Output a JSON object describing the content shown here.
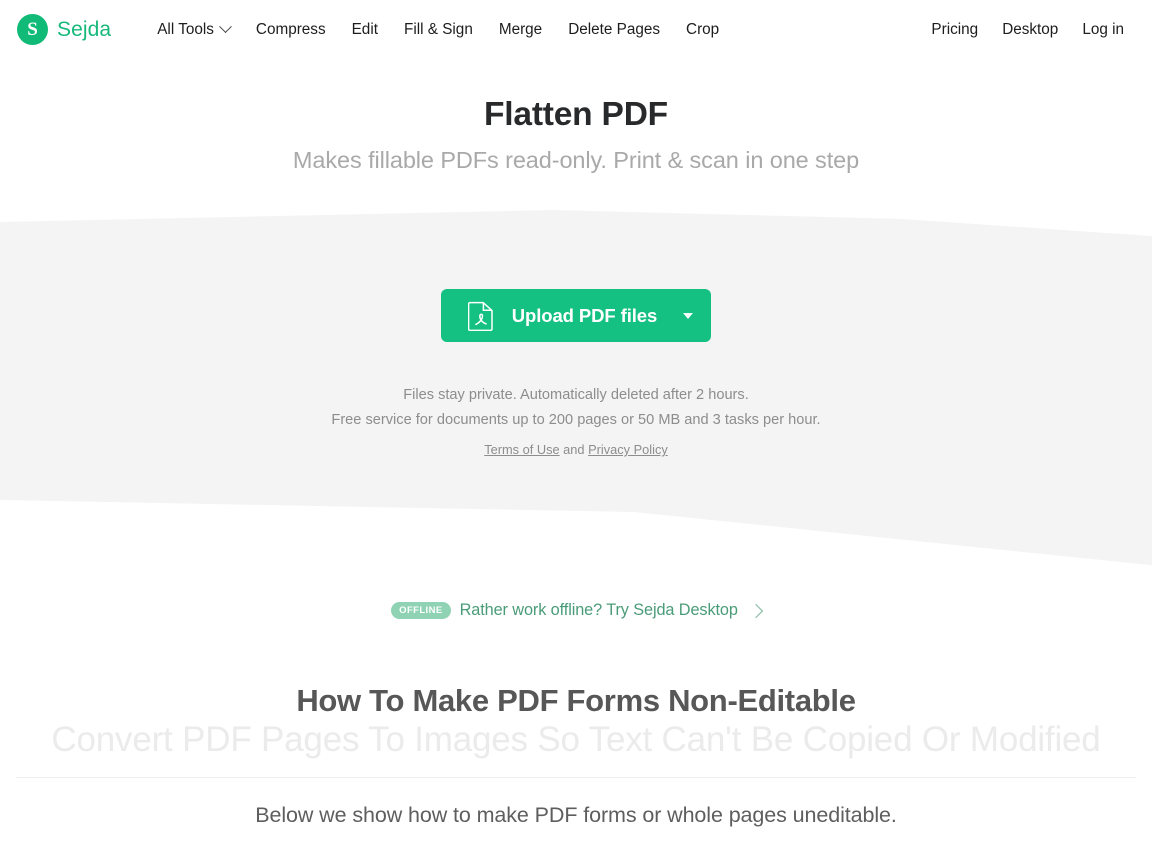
{
  "brand": {
    "mark_letter": "S",
    "name": "Sejda"
  },
  "nav": {
    "main": [
      {
        "label": "All Tools",
        "has_caret": true
      },
      {
        "label": "Compress",
        "has_caret": false
      },
      {
        "label": "Edit",
        "has_caret": false
      },
      {
        "label": "Fill & Sign",
        "has_caret": false
      },
      {
        "label": "Merge",
        "has_caret": false
      },
      {
        "label": "Delete Pages",
        "has_caret": false
      },
      {
        "label": "Crop",
        "has_caret": false
      }
    ],
    "right": [
      {
        "label": "Pricing"
      },
      {
        "label": "Desktop"
      },
      {
        "label": "Log in"
      }
    ]
  },
  "hero": {
    "title": "Flatten PDF",
    "subtitle": "Makes fillable PDFs read-only. Print & scan in one step"
  },
  "upload": {
    "label": "Upload PDF files",
    "icon": "pdf-file-icon",
    "caret_icon": "caret-down-icon"
  },
  "fineprint": {
    "line1": "Files stay private. Automatically deleted after 2 hours.",
    "line2": "Free service for documents up to 200 pages or 50 MB and 3 tasks per hour.",
    "terms_label": "Terms of Use",
    "conjunction": " and ",
    "privacy_label": "Privacy Policy"
  },
  "offline": {
    "badge": "OFFLINE",
    "text": "Rather work offline? Try Sejda Desktop",
    "arrow_icon": "chevron-right-icon"
  },
  "section": {
    "heading": "How To Make PDF Forms Non-Editable",
    "ghost_heading": "Convert PDF Pages To Images So Text Can't Be Copied Or Modified",
    "lede": "Below we show how to make PDF forms or whole pages uneditable."
  },
  "colors": {
    "brand_green": "#17b97b",
    "button_green": "#14c183",
    "band_gray": "#f4f4f4",
    "offline_green": "#4a9c78",
    "badge_green": "#8fd3b4"
  }
}
